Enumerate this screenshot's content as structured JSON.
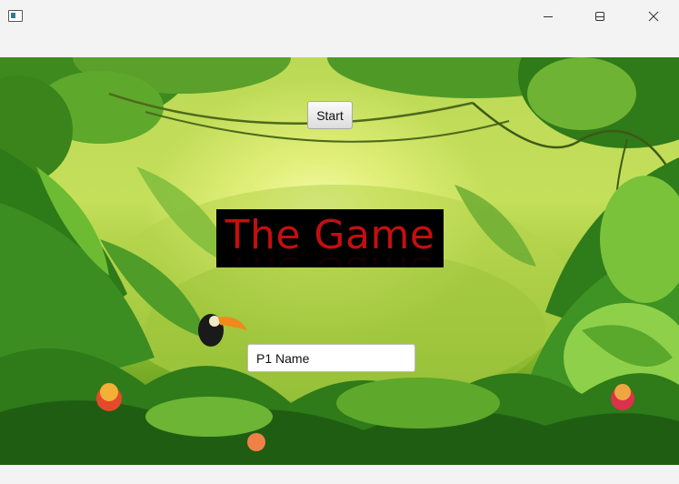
{
  "window": {
    "title": "",
    "controls": [
      "minimize-icon",
      "maximize-icon",
      "close-icon"
    ]
  },
  "start_button": {
    "label": "Start"
  },
  "game_title": {
    "text": "The Game"
  },
  "player_name": {
    "value": "P1 Name",
    "placeholder": ""
  },
  "colors": {
    "title_text": "#c40f0f",
    "title_background": "#000000",
    "window_chrome": "#f3f3f3"
  },
  "background": {
    "scene": "jungle"
  }
}
